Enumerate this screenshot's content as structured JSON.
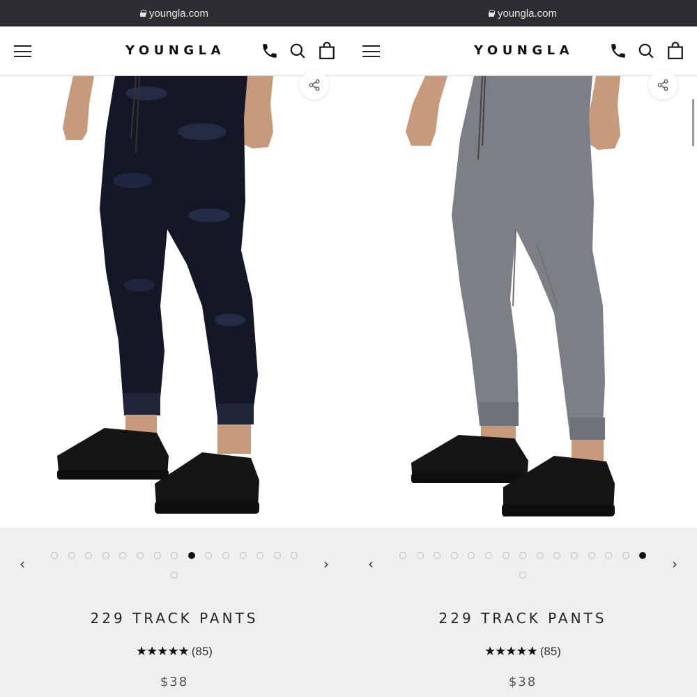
{
  "panels": [
    {
      "browser": {
        "url": "youngla.com"
      },
      "header": {
        "logo": "YOUNGLA"
      },
      "product": {
        "image_alt": "Black camo track pants on model with black sneakers",
        "pants_color": "#141826",
        "title": "229 TRACK PANTS",
        "stars": "★★★★★",
        "review_count": "(85)",
        "price": "$38"
      },
      "carousel": {
        "prev": "‹",
        "next": "›",
        "active_index": 8
      }
    },
    {
      "browser": {
        "url": "youngla.com"
      },
      "header": {
        "logo": "YOUNGLA"
      },
      "product": {
        "image_alt": "Grey track pants on model with black sneakers",
        "pants_color": "#7c7f85",
        "title": "229 TRACK PANTS",
        "stars": "★★★★★",
        "review_count": "(85)",
        "price": "$38"
      },
      "carousel": {
        "prev": "‹",
        "next": "›",
        "active_index": 14
      }
    }
  ]
}
